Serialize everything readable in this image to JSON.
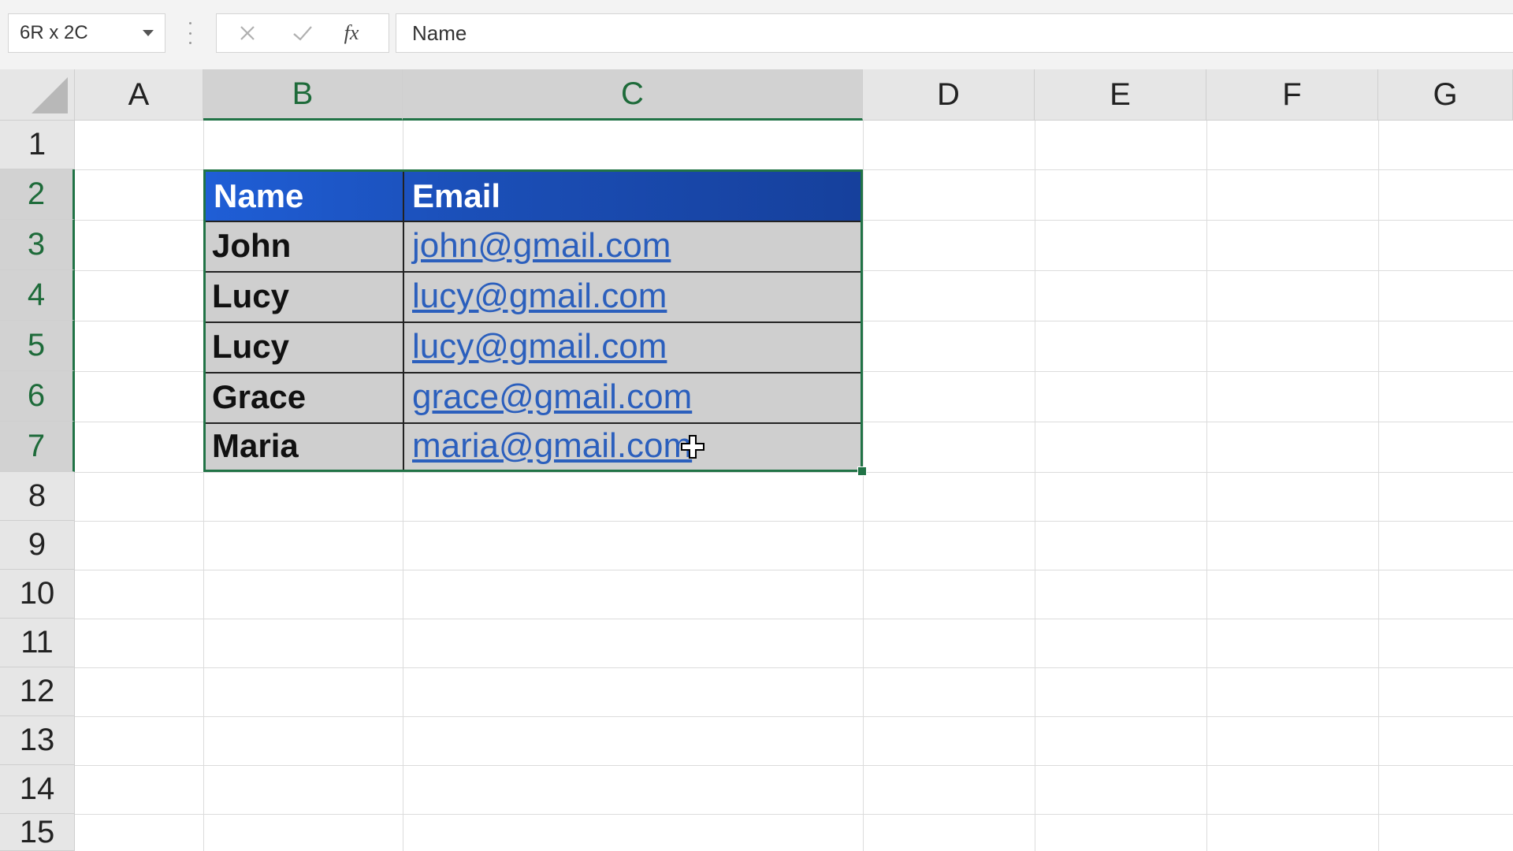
{
  "formula_bar": {
    "name_box": "6R x 2C",
    "cancel_icon": "close-icon",
    "enter_icon": "checkmark-icon",
    "function_label": "fx",
    "formula": "Name"
  },
  "columns": [
    "A",
    "B",
    "C",
    "D",
    "E",
    "F",
    "G"
  ],
  "rows": [
    "1",
    "2",
    "3",
    "4",
    "5",
    "6",
    "7",
    "8",
    "9",
    "10",
    "11",
    "12",
    "13",
    "14",
    "15"
  ],
  "selection": {
    "columns": [
      "B",
      "C"
    ],
    "rows": [
      "2",
      "3",
      "4",
      "5",
      "6",
      "7"
    ]
  },
  "table": {
    "headers": {
      "name": "Name",
      "email": "Email"
    },
    "records": [
      {
        "name": "John",
        "email": "john@gmail.com"
      },
      {
        "name": "Lucy",
        "email": "lucy@gmail.com"
      },
      {
        "name": "Lucy",
        "email": "lucy@gmail.com"
      },
      {
        "name": "Grace",
        "email": "grace@gmail.com"
      },
      {
        "name": "Maria",
        "email": "maria@gmail.com"
      }
    ]
  },
  "colors": {
    "header_fill": "#1b4fb8",
    "selection_border": "#217346",
    "hyperlink": "#2b5fbd",
    "selected_fill": "#cfcfcf"
  },
  "cursor_icon": "move-cursor-icon"
}
